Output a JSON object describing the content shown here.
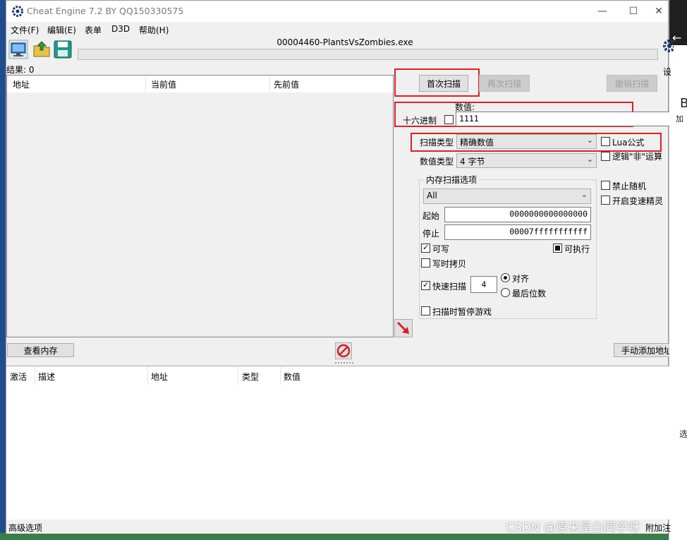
{
  "window": {
    "title": "Cheat Engine 7.2 BY QQ150330575",
    "minimize_glyph": "—",
    "maximize_glyph": "☐",
    "close_glyph": "✕"
  },
  "menu": {
    "items": [
      "文件(F)",
      "编辑(E)",
      "表单",
      "D3D",
      "帮助(H)"
    ]
  },
  "toolbar": {
    "icons": [
      "select-process-icon",
      "open-file-icon",
      "save-file-icon"
    ]
  },
  "process_name": "00004460-PlantsVsZombies.exe",
  "results": {
    "label": "结果: 0",
    "columns": [
      "地址",
      "当前值",
      "先前值"
    ]
  },
  "scan": {
    "first_scan": "首次扫描",
    "next_scan": "再次扫描",
    "undo_scan": "撤销扫描",
    "value_label": "数值:",
    "hex_label": "十六进制",
    "value": "1111",
    "scan_type_label": "扫描类型",
    "scan_type": "精确数值",
    "value_type_label": "数值类型",
    "value_type": "4 字节",
    "lua_formula": "Lua公式",
    "not_logic": "逻辑\"非\"运算",
    "disable_random": "禁止随机",
    "speedhack": "开启变速精灵"
  },
  "memory_options": {
    "title": "内存扫描选项",
    "region": "All",
    "start_label": "起始",
    "start_value": "0000000000000000",
    "stop_label": "停止",
    "stop_value": "00007fffffffffff",
    "writable": "可写",
    "executable": "可执行",
    "copy_on_write": "写时拷贝",
    "fast_scan": "快速扫描",
    "fast_scan_value": "4",
    "alignment": "对齐",
    "last_digits": "最后位数",
    "pause_game": "扫描时暂停游戏"
  },
  "actions": {
    "view_memory": "查看内存",
    "add_manually": "手动添加地址"
  },
  "address_list": {
    "columns": [
      "激活",
      "描述",
      "地址",
      "类型",
      "数值"
    ]
  },
  "bottom": {
    "advanced": "高级选项",
    "append": "附加注"
  },
  "side_panel": {
    "settings_fragment": "设",
    "b_fragment": "B",
    "add_fragment": "加",
    "select_fragment": "选"
  },
  "watermark": "CSDN @原来是白同学呀",
  "colors": {
    "highlight_box": "#e02020",
    "window_bg": "#f0f0f0"
  }
}
